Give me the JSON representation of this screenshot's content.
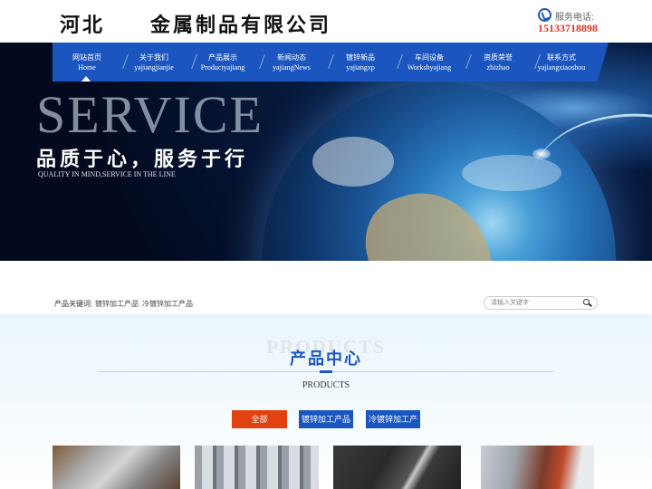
{
  "header": {
    "company_name": "河北　　金属制品有限公司",
    "phone_label": "服务电话:",
    "phone_number": "15133718898",
    "phone_icon": "phone-icon"
  },
  "nav": {
    "items": [
      {
        "cn": "网站首页",
        "en": "Home"
      },
      {
        "cn": "关于我们",
        "en": "yajiangjianjie"
      },
      {
        "cn": "产品展示",
        "en": "Productyajiang"
      },
      {
        "cn": "新闻动态",
        "en": "yajiangNews"
      },
      {
        "cn": "镀锌新品",
        "en": "yajiangxp"
      },
      {
        "cn": "车间设备",
        "en": "Workshyajiang"
      },
      {
        "cn": "资质荣誉",
        "en": "zhizhao"
      },
      {
        "cn": "联系方式",
        "en": "yajiangxiaoshou"
      }
    ],
    "active_index": 0,
    "color": "#1b56c0"
  },
  "banner": {
    "title": "SERVICE",
    "subtitle": "品质于心，服务于行",
    "subtitle_en": "QUALITY IN MIND,SERVICE IN THE LINE"
  },
  "search": {
    "keywords_label": "产品关键词:",
    "keywords": [
      "镀锌加工产品",
      "冷镀锌加工产品"
    ],
    "placeholder": "请输入关键字",
    "search_icon": "search-icon"
  },
  "products": {
    "watermark": "PRODUCTS",
    "title": "产品中心",
    "subtitle": "PRODUCTS",
    "tabs": [
      "全部",
      "镀锌加工产品",
      "冷镀锌加工产品"
    ],
    "active_tab_color": "#e0430f"
  }
}
